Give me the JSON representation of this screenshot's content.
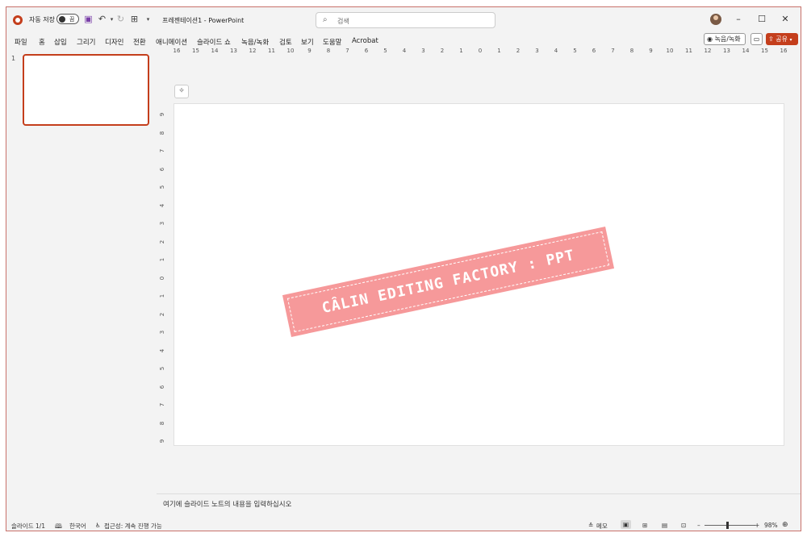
{
  "titlebar": {
    "autosave_label": "자동 저장",
    "autosave_state": "끔",
    "doc_title": "프레젠테이션1  -  PowerPoint",
    "search_placeholder": "검색",
    "minimize": "–",
    "maximize": "☐",
    "close": "✕"
  },
  "ribbon": {
    "tabs": [
      "파일",
      "홈",
      "삽입",
      "그리기",
      "디자인",
      "전환",
      "애니메이션",
      "슬라이드 쇼",
      "녹음/녹화",
      "검토",
      "보기",
      "도움말",
      "Acrobat"
    ],
    "record_button": "녹음/녹화",
    "share_button": "공유"
  },
  "thumbnails": {
    "slide_number": "1"
  },
  "ruler": {
    "horizontal": [
      "16",
      "15",
      "14",
      "13",
      "12",
      "11",
      "10",
      "9",
      "8",
      "7",
      "6",
      "5",
      "4",
      "3",
      "2",
      "1",
      "0",
      "1",
      "2",
      "3",
      "4",
      "5",
      "6",
      "7",
      "8",
      "9",
      "10",
      "11",
      "12",
      "13",
      "14",
      "15",
      "16"
    ],
    "vertical": [
      "9",
      "8",
      "7",
      "6",
      "5",
      "4",
      "3",
      "2",
      "1",
      "0",
      "1",
      "2",
      "3",
      "4",
      "5",
      "6",
      "7",
      "8",
      "9"
    ]
  },
  "slide": {
    "banner_text": "CÂLIN EDITING FACTORY : PPT",
    "banner_color": "#f6999a"
  },
  "notes": {
    "placeholder": "여기에 슬라이드 노트의 내용을 입력하십시오"
  },
  "status": {
    "slide_info": "슬라이드 1/1",
    "language": "한국어",
    "accessibility": "접근성: 계속 진행 가능",
    "notes_button": "메모",
    "zoom_minus": "–",
    "zoom_plus": "+",
    "zoom_level": "98%"
  },
  "colors": {
    "accent": "#c43e1c"
  }
}
